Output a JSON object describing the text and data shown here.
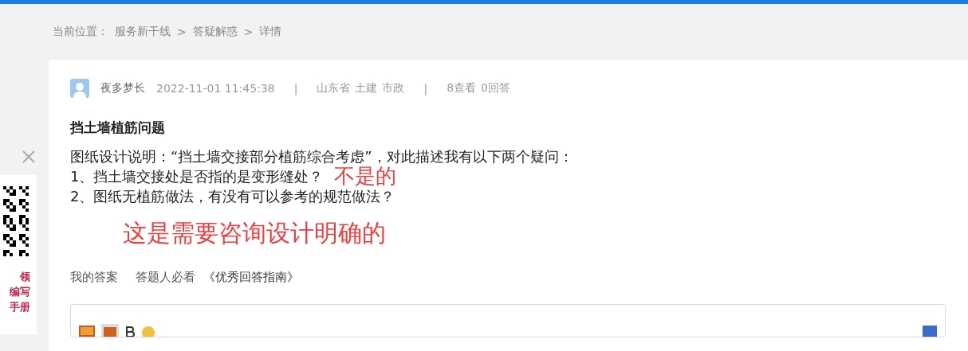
{
  "breadcrumb": {
    "label": "当前位置：",
    "items": [
      "服务新干线",
      "答疑解惑",
      "详情"
    ],
    "separator": ">"
  },
  "question": {
    "author": "夜多梦长",
    "time": "2022-11-01 11:45:38",
    "region": "山东省",
    "tags": [
      "土建",
      "市政"
    ],
    "views": "8查看",
    "answers": "0回答",
    "title": "挡土墙植筋问题",
    "separator": "|",
    "lines": [
      {
        "text": "图纸设计说明：“挡土墙交接部分植筋综合考虑”，对此描述我有以下两个疑问："
      },
      {
        "text": "1、挡土墙交接处是否指的是变形缝处？",
        "note": "不是的"
      },
      {
        "text": "2、图纸无植筋做法，有没有可以参考的规范做法？"
      }
    ],
    "annotation": "这是需要咨询设计明确的"
  },
  "answer_tabs": {
    "mine": "我的答案",
    "guide_prefix": "答题人必看",
    "guide_link": "《优秀回答指南》"
  },
  "side_ad": {
    "lines": [
      "领",
      "编写",
      "手册"
    ]
  }
}
